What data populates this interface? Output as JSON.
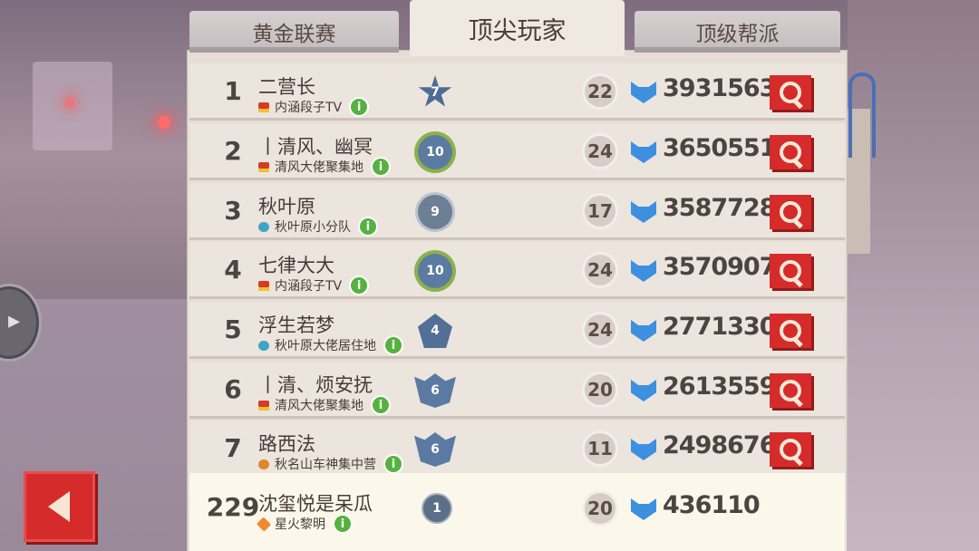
{
  "tabs": [
    {
      "label": "黄金联赛",
      "active": false
    },
    {
      "label": "顶尖玩家",
      "active": true
    },
    {
      "label": "顶级帮派",
      "active": false
    }
  ],
  "rows": [
    {
      "rank": "1",
      "name": "二营长",
      "clan": "内涵段子TV",
      "clan_icon": "crown-icon",
      "badge": "7",
      "badge_icon": "star-icon",
      "level": "22",
      "score": "3931563"
    },
    {
      "rank": "2",
      "name": "丨清风、幽冥",
      "clan": "清风大佬聚集地",
      "clan_icon": "crown-icon",
      "badge": "10",
      "badge_icon": "laurel-icon",
      "level": "24",
      "score": "3650551"
    },
    {
      "rank": "3",
      "name": "秋叶原",
      "clan": "秋叶原小分队",
      "clan_icon": "wolf-icon",
      "badge": "9",
      "badge_icon": "circle-star-icon",
      "level": "17",
      "score": "3587728"
    },
    {
      "rank": "4",
      "name": "七律大大",
      "clan": "内涵段子TV",
      "clan_icon": "crown-icon",
      "badge": "10",
      "badge_icon": "laurel-icon",
      "level": "24",
      "score": "3570907"
    },
    {
      "rank": "5",
      "name": "浮生若梦",
      "clan": "秋叶原大佬居住地",
      "clan_icon": "wolf-icon",
      "badge": "4",
      "badge_icon": "pentagon-icon",
      "level": "24",
      "score": "2771330"
    },
    {
      "rank": "6",
      "name": "丨清、烦安抚",
      "clan": "清风大佬聚集地",
      "clan_icon": "crown-icon",
      "badge": "6",
      "badge_icon": "shield-icon",
      "level": "20",
      "score": "2613559"
    },
    {
      "rank": "7",
      "name": "路西法",
      "clan": "秋名山车神集中营",
      "clan_icon": "paw-icon",
      "badge": "6",
      "badge_icon": "shield-icon",
      "level": "11",
      "score": "2498676"
    }
  ],
  "me": {
    "rank": "229",
    "name": "沈玺悦是呆瓜",
    "clan": "星火黎明",
    "clan_icon": "fire-icon",
    "badge": "1",
    "badge_icon": "dot-icon",
    "level": "20",
    "score": "436110"
  },
  "info_glyph": "i",
  "colors": {
    "accent_red": "#d62b2b",
    "gem_blue": "#3d8fe0",
    "info_green": "#56b23f"
  }
}
